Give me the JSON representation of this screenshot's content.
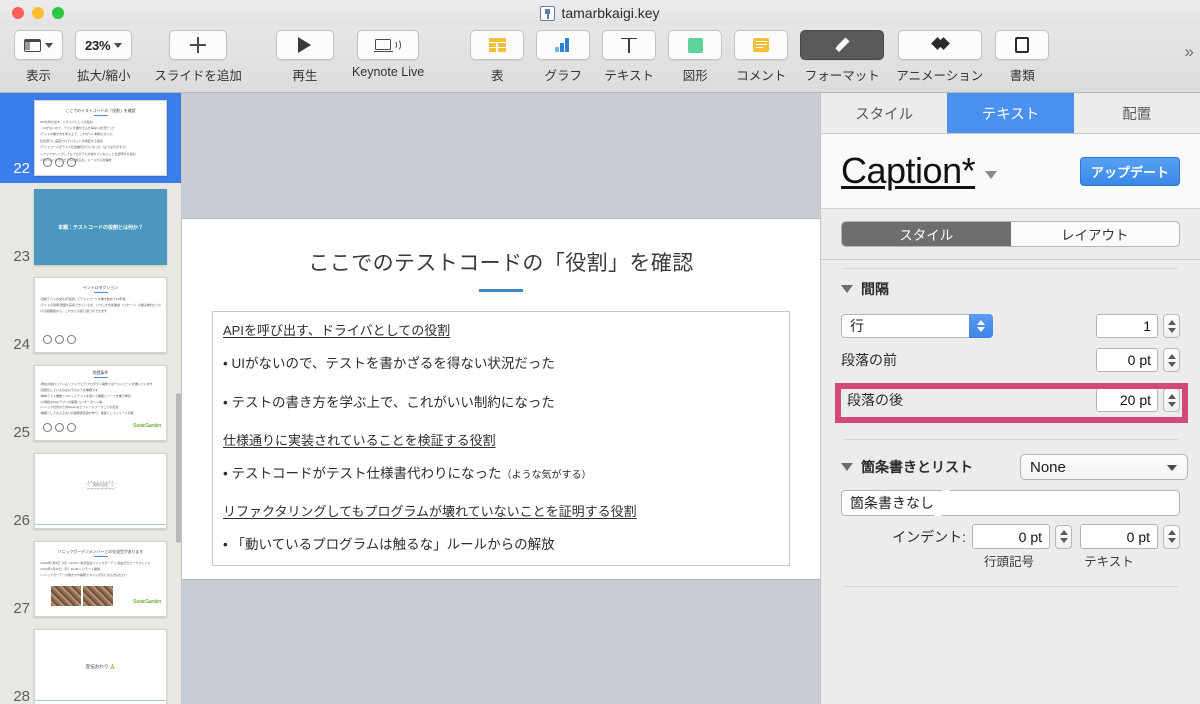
{
  "window": {
    "title": "tamarbkaigi.key",
    "doc_icon": "keynote-document-icon"
  },
  "toolbar": {
    "items": [
      {
        "label": "表示",
        "icon": "view-layout-icon",
        "value": ""
      },
      {
        "label": "拡大/縮小",
        "icon": "zoom-icon",
        "value": "23%"
      },
      {
        "label": "スライドを追加",
        "icon": "plus-icon",
        "value": ""
      },
      {
        "label": "再生",
        "icon": "play-icon",
        "value": ""
      },
      {
        "label": "Keynote Live",
        "icon": "broadcast-icon",
        "value": ""
      },
      {
        "label": "表",
        "icon": "table-icon",
        "value": ""
      },
      {
        "label": "グラフ",
        "icon": "chart-icon",
        "value": ""
      },
      {
        "label": "テキスト",
        "icon": "text-icon",
        "value": ""
      },
      {
        "label": "図形",
        "icon": "shape-icon",
        "value": ""
      },
      {
        "label": "コメント",
        "icon": "comment-icon",
        "value": ""
      },
      {
        "label": "フォーマット",
        "icon": "format-brush-icon",
        "value": "",
        "active": true
      },
      {
        "label": "アニメーション",
        "icon": "animate-icon",
        "value": ""
      },
      {
        "label": "書類",
        "icon": "document-icon",
        "value": ""
      }
    ],
    "overflow": "»"
  },
  "navigator": {
    "slides": [
      {
        "number": "22",
        "selected": true,
        "kind": "content",
        "title": "ここでのテストコードの「役割」を確認",
        "lines": [
          "APIを呼び出す、ドライバとしての役割",
          "・UIがないので、テストを書かざるを得ない状況だった",
          "・テストの書き方を学ぶ上で、これがいい制約になった",
          "仕様通りに実装されていることを検証する役割",
          "・テストコードがテスト仕様書代わりになった（ような気がする）",
          "リファクタリングしてもプログラムが壊れていないことを証明する役割",
          "・「動いているプログラムは触るな」ルールからの解放"
        ]
      },
      {
        "number": "23",
        "selected": false,
        "kind": "blue-title",
        "title": "本題：テストコードの役割とは何か？",
        "lines": []
      },
      {
        "number": "24",
        "selected": false,
        "kind": "content-circles",
        "title": "イントロダクション",
        "lines": [
          "・自動テストの文化が浸透してテストコードを書き始めて10年強",
          "・テストの効果・価値を実感できているが、いつしかの失敗談（パターン）の積み重ねだった",
          "・その経験談から、これからの振り返りができます"
        ]
      },
      {
        "number": "25",
        "selected": false,
        "kind": "content-circles-sg",
        "title": "前提条件",
        "lines": [
          "・現在の携わっているソフトウェア・プロダクト開発ではテストコードを書いています",
          "・自動化しているのは以下のような種類です",
          "  ・単体テスト機能とユニットテストを用いて機能とソースを補う単位",
          "  ・小規模なWebアプリの開発・コンポーネント等",
          "  ・ソニック社内のためRspecなどフレームワークごとの記述",
          "  ・機能としてのふるまいが開発者自身が作り、検証としてリリース可能"
        ],
        "sonic": "SonicGarden"
      },
      {
        "number": "26",
        "selected": false,
        "kind": "ascii",
        "ascii": "＿人人人人人人人人人＿\n＞　突然の宣伝　＜\n￣Y^Y^Y^Y^Y^Y^Y^Y￣",
        "lines": []
      },
      {
        "number": "27",
        "selected": false,
        "kind": "photos",
        "title": "ソニックガーデンメンバーとの交流会があります",
        "lines": [
          "・2019年7月8日（月）19:00〜 株式会社ソニックガーデン 自由が丘ワークプレイス",
          "・2019年7月22日（月）19:00〜 リモート開催",
          "・ソニックガーデンの働き方や開発スタイルが気になる方はぜひ！"
        ],
        "sonic": "SonicGarden"
      },
      {
        "number": "28",
        "selected": false,
        "kind": "center-text",
        "title": "宣伝おわり 🙏",
        "lines": []
      }
    ]
  },
  "slide": {
    "title": "ここでのテストコードの「役割」を確認",
    "blocks": [
      {
        "heading": "APIを呼び出す、ドライバとしての役割",
        "bullets": [
          {
            "text": "• UIがないので、テストを書かざるを得ない状況だった",
            "note": ""
          },
          {
            "text": "• テストの書き方を学ぶ上で、これがいい制約になった",
            "note": ""
          }
        ]
      },
      {
        "heading": "仕様通りに実装されていることを検証する役割",
        "bullets": [
          {
            "text": "• テストコードがテスト仕様書代わりになった",
            "note": "（ような気がする）"
          }
        ]
      },
      {
        "heading": "リファクタリングしてもプログラムが壊れていないことを証明する役割",
        "bullets": [
          {
            "text": "• 「動いているプログラムは触るな」ルールからの解放",
            "note": ""
          }
        ]
      }
    ]
  },
  "inspector": {
    "tabs": [
      {
        "label": "スタイル",
        "active": false
      },
      {
        "label": "テキスト",
        "active": true
      },
      {
        "label": "配置",
        "active": false
      }
    ],
    "style_name": "Caption*",
    "update_label": "アップデート",
    "segments": [
      {
        "label": "スタイル",
        "active": true
      },
      {
        "label": "レイアウト",
        "active": false
      }
    ],
    "spacing": {
      "section_title": "間隔",
      "line_mode": "行",
      "line_value": "1",
      "before_label": "段落の前",
      "before_value": "0 pt",
      "after_label": "段落の後",
      "after_value": "20 pt",
      "highlight_color": "#d4497b"
    },
    "bullets": {
      "section_title": "箇条書きとリスト",
      "list_style": "None",
      "bullet_type": "箇条書きなし",
      "indent_label": "インデント:",
      "indent_bullet_value": "0 pt",
      "indent_text_value": "0 pt",
      "caption_bullet": "行頭記号",
      "caption_text": "テキスト"
    }
  },
  "colors": {
    "accent_blue": "#4a90f0",
    "canvas_bg": "#c8cdd5",
    "navigator_bg": "#e8e7e1",
    "selection_blue": "#3b7dea",
    "highlight_pink": "#d4497b"
  }
}
